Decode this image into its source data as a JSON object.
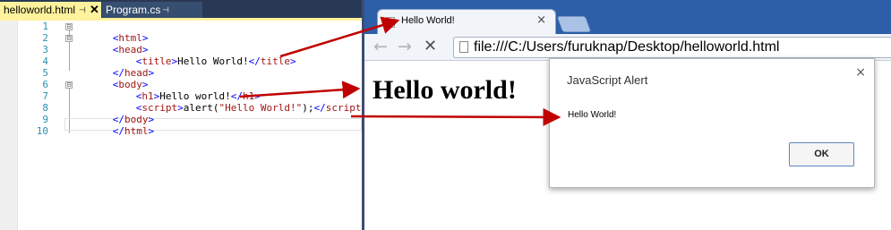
{
  "editor": {
    "tabs": [
      {
        "label": "helloworld.html",
        "pin": "⊣",
        "close": "✕"
      },
      {
        "label": "Program.cs",
        "pin": "⊣"
      }
    ],
    "line_numbers": [
      "1",
      "2",
      "3",
      "4",
      "5",
      "6",
      "7",
      "8",
      "9",
      "10"
    ],
    "fold_markers": [
      "⊟",
      "⊟",
      "⊟"
    ],
    "code": [
      {
        "lt": "<",
        "tag": "html",
        "gt": ">"
      },
      {
        "lt": "<",
        "tag": "head",
        "gt": ">"
      },
      {
        "lt": "<",
        "tag": "title",
        "gt": ">",
        "text": "Hello World!",
        "close_lt": "</",
        "close_tag": "title",
        "close_gt": ">"
      },
      {
        "lt": "</",
        "tag": "head",
        "gt": ">"
      },
      {
        "lt": "<",
        "tag": "body",
        "gt": ">"
      },
      {
        "lt": "<",
        "tag": "h1",
        "gt": ">",
        "text": "Hello world!",
        "close_lt": "</",
        "close_tag": "h1",
        "close_gt": ">"
      },
      {
        "lt": "<",
        "tag": "script",
        "gt": ">",
        "text": "alert(",
        "string": "\"Hello World!\"",
        "text2": ");",
        "close_lt": "</",
        "close_tag": "script",
        "close_gt": ">"
      },
      {
        "lt": "</",
        "tag": "body",
        "gt": ">"
      },
      {
        "lt": "</",
        "tag": "html",
        "gt": ">"
      }
    ]
  },
  "browser": {
    "tab_title": "Hello World!",
    "tab_close": "×",
    "back": "←",
    "forward": "→",
    "stop": "✕",
    "url": "file:///C:/Users/furuknap/Desktop/helloworld.html",
    "page_heading": "Hello world!",
    "alert": {
      "title": "JavaScript Alert",
      "close": "×",
      "message": "Hello World!",
      "ok": "OK"
    }
  },
  "colors": {
    "arrow": "#c00000",
    "tab_strip": "#2d5ea8",
    "vs_active_tab": "#fff29d",
    "vs_tab_bar": "#293955"
  },
  "icons": [
    "pin-icon",
    "close-icon",
    "favicon-icon",
    "back-arrow-icon",
    "forward-arrow-icon",
    "stop-icon",
    "page-icon"
  ]
}
